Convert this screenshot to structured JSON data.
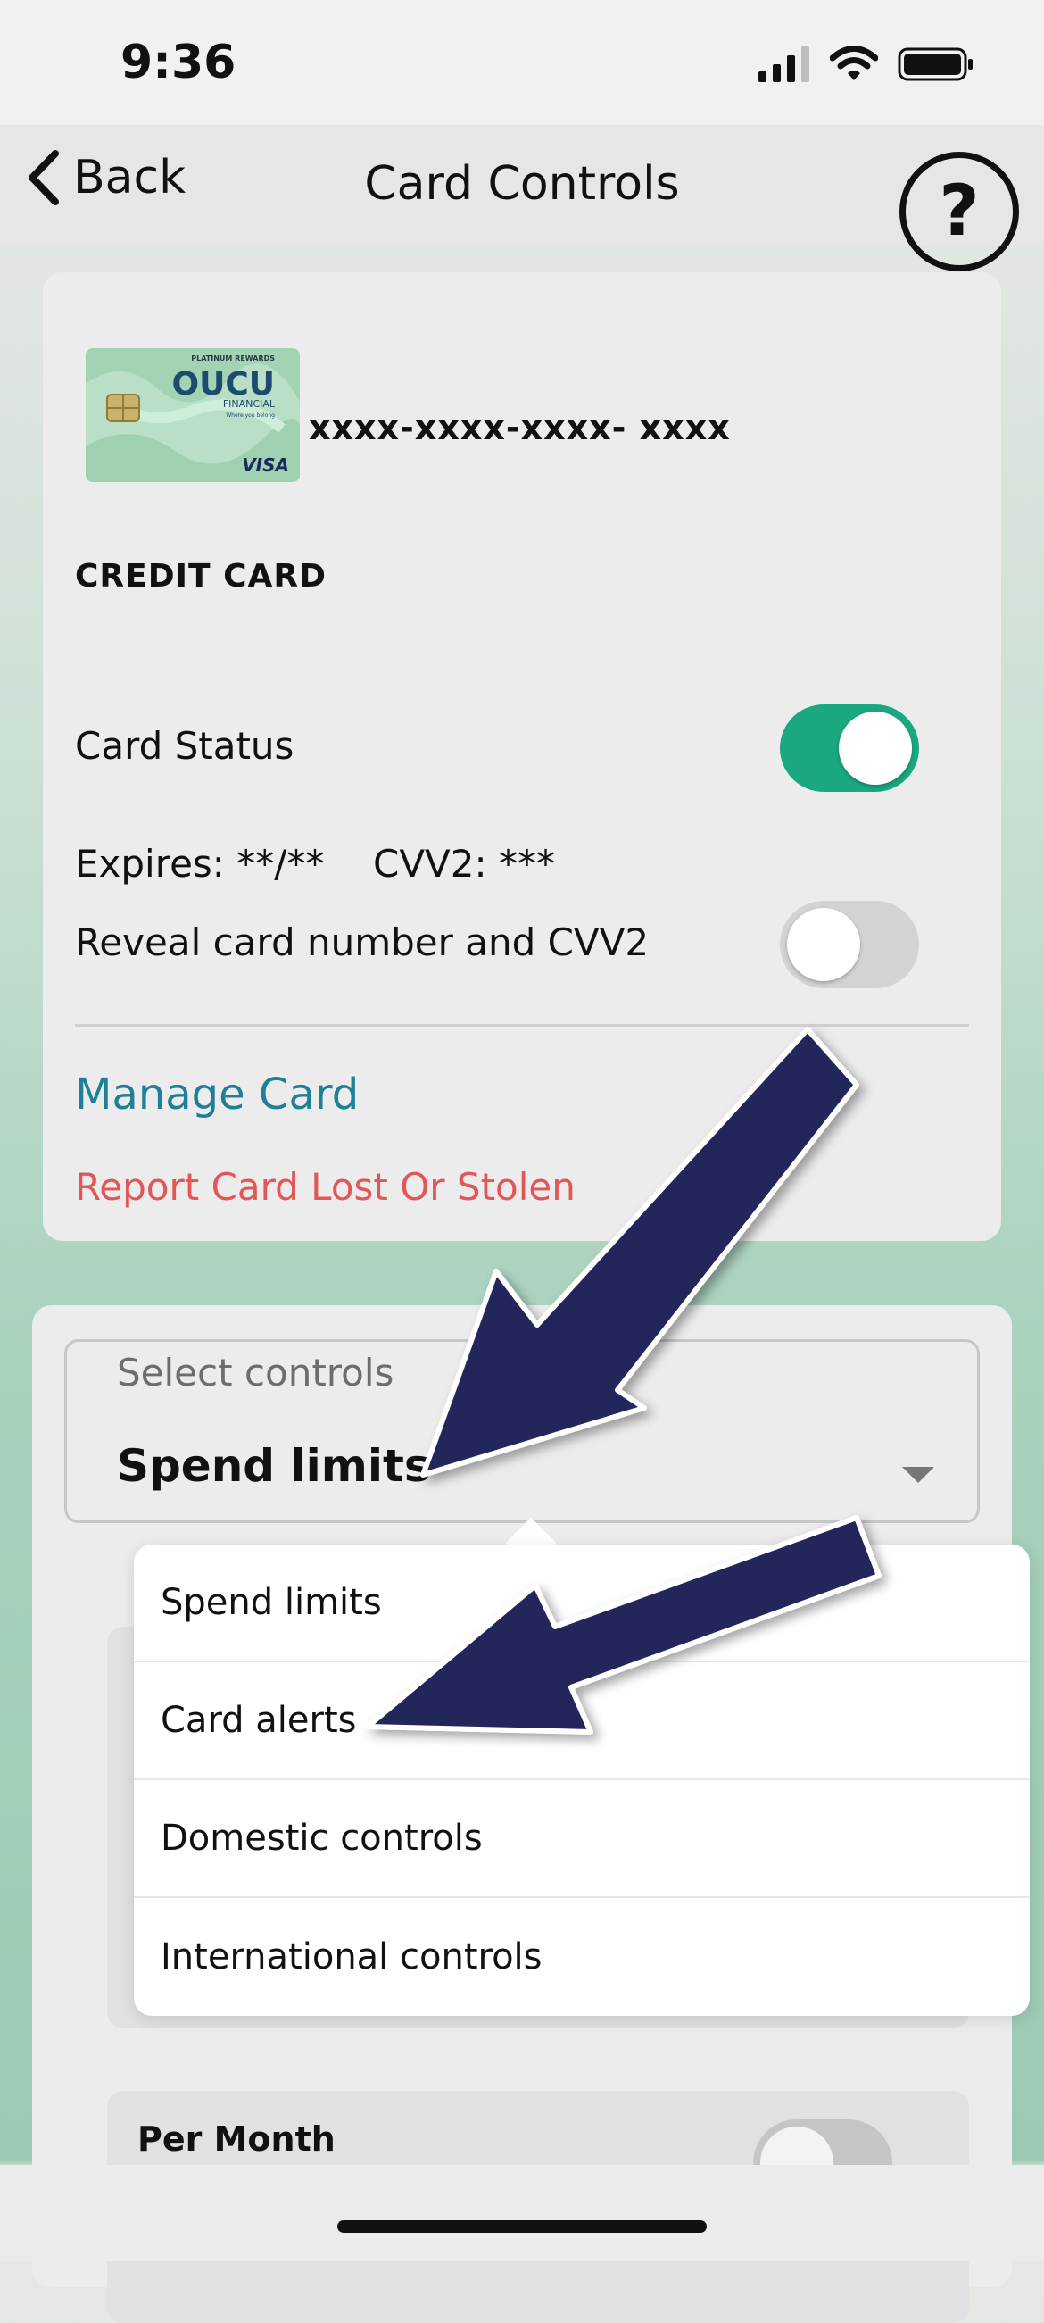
{
  "status_bar": {
    "time": "9:36"
  },
  "nav": {
    "back_label": "Back",
    "title": "Card Controls",
    "help_label": "?"
  },
  "card": {
    "brand": "OUCU",
    "brand_sub": "FINANCIAL",
    "tier": "PLATINUM REWARDS",
    "tagline": "Where you belong",
    "network": "VISA",
    "number_masked": "xxxx-xxxx-xxxx- xxxx",
    "type": "CREDIT CARD",
    "status_label": "Card Status",
    "status_on": true,
    "expires_label": "Expires: **/**",
    "cvv_label": "CVV2: ***",
    "reveal_label": "Reveal card number and CVV2",
    "reveal_on": false,
    "manage_link": "Manage Card",
    "report_link": "Report Card Lost Or Stolen"
  },
  "controls": {
    "select_label": "Select controls",
    "selected_value": "Spend limits",
    "options": [
      "Spend limits",
      "Card alerts",
      "Domestic controls",
      "International controls"
    ],
    "per_month_label": "Per Month"
  },
  "colors": {
    "toggle_on": "#1aa881",
    "link_teal": "#1f7f96",
    "link_red": "#e35658",
    "arrow_navy": "#22255a"
  }
}
